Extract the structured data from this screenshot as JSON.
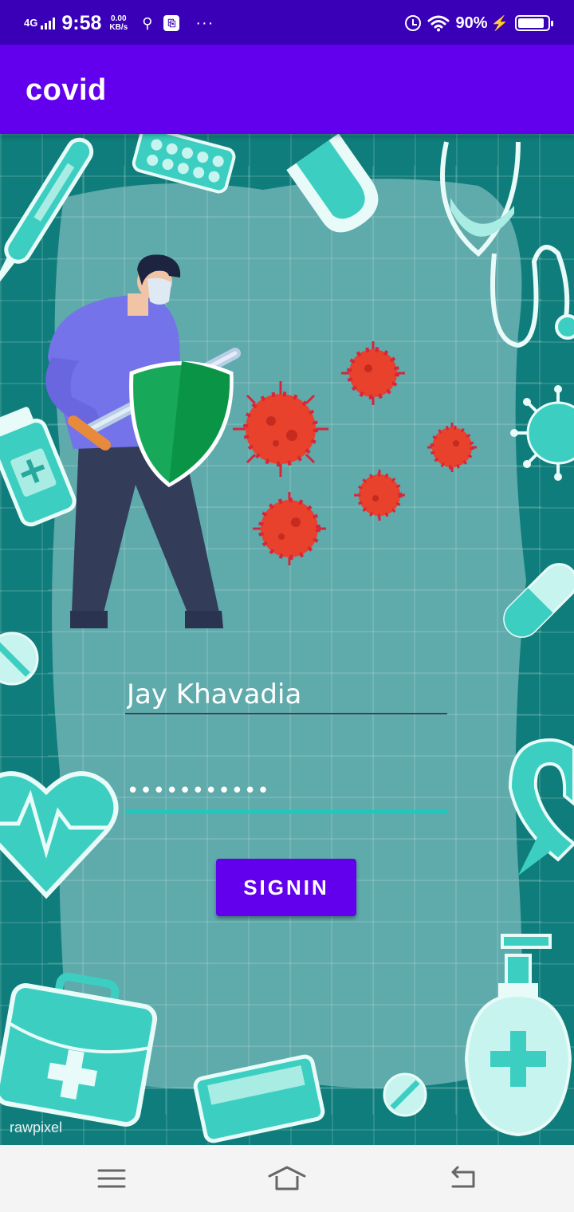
{
  "status_bar": {
    "network": "4G",
    "time": "9:58",
    "speed_value": "0.00",
    "speed_unit": "KB/s",
    "overflow": "···",
    "battery": "90%"
  },
  "app_bar": {
    "title": "covid"
  },
  "login": {
    "username_value": "Jay Khavadia",
    "password_value": "•••••••••••",
    "signin_label": "SIGNIN"
  },
  "watermark": "rawpixel",
  "icons": {
    "status": [
      "signal-icon",
      "usb-icon",
      "notification-icon",
      "alarm-icon",
      "wifi-icon",
      "battery-icon"
    ],
    "nav": [
      "menu-icon",
      "home-icon",
      "back-icon"
    ]
  },
  "colors": {
    "status_bar": "#3a00b8",
    "app_bar": "#6200ee",
    "button": "#6200ee",
    "background": "#0f7d7b",
    "accent_underline": "#1fc8bc"
  }
}
